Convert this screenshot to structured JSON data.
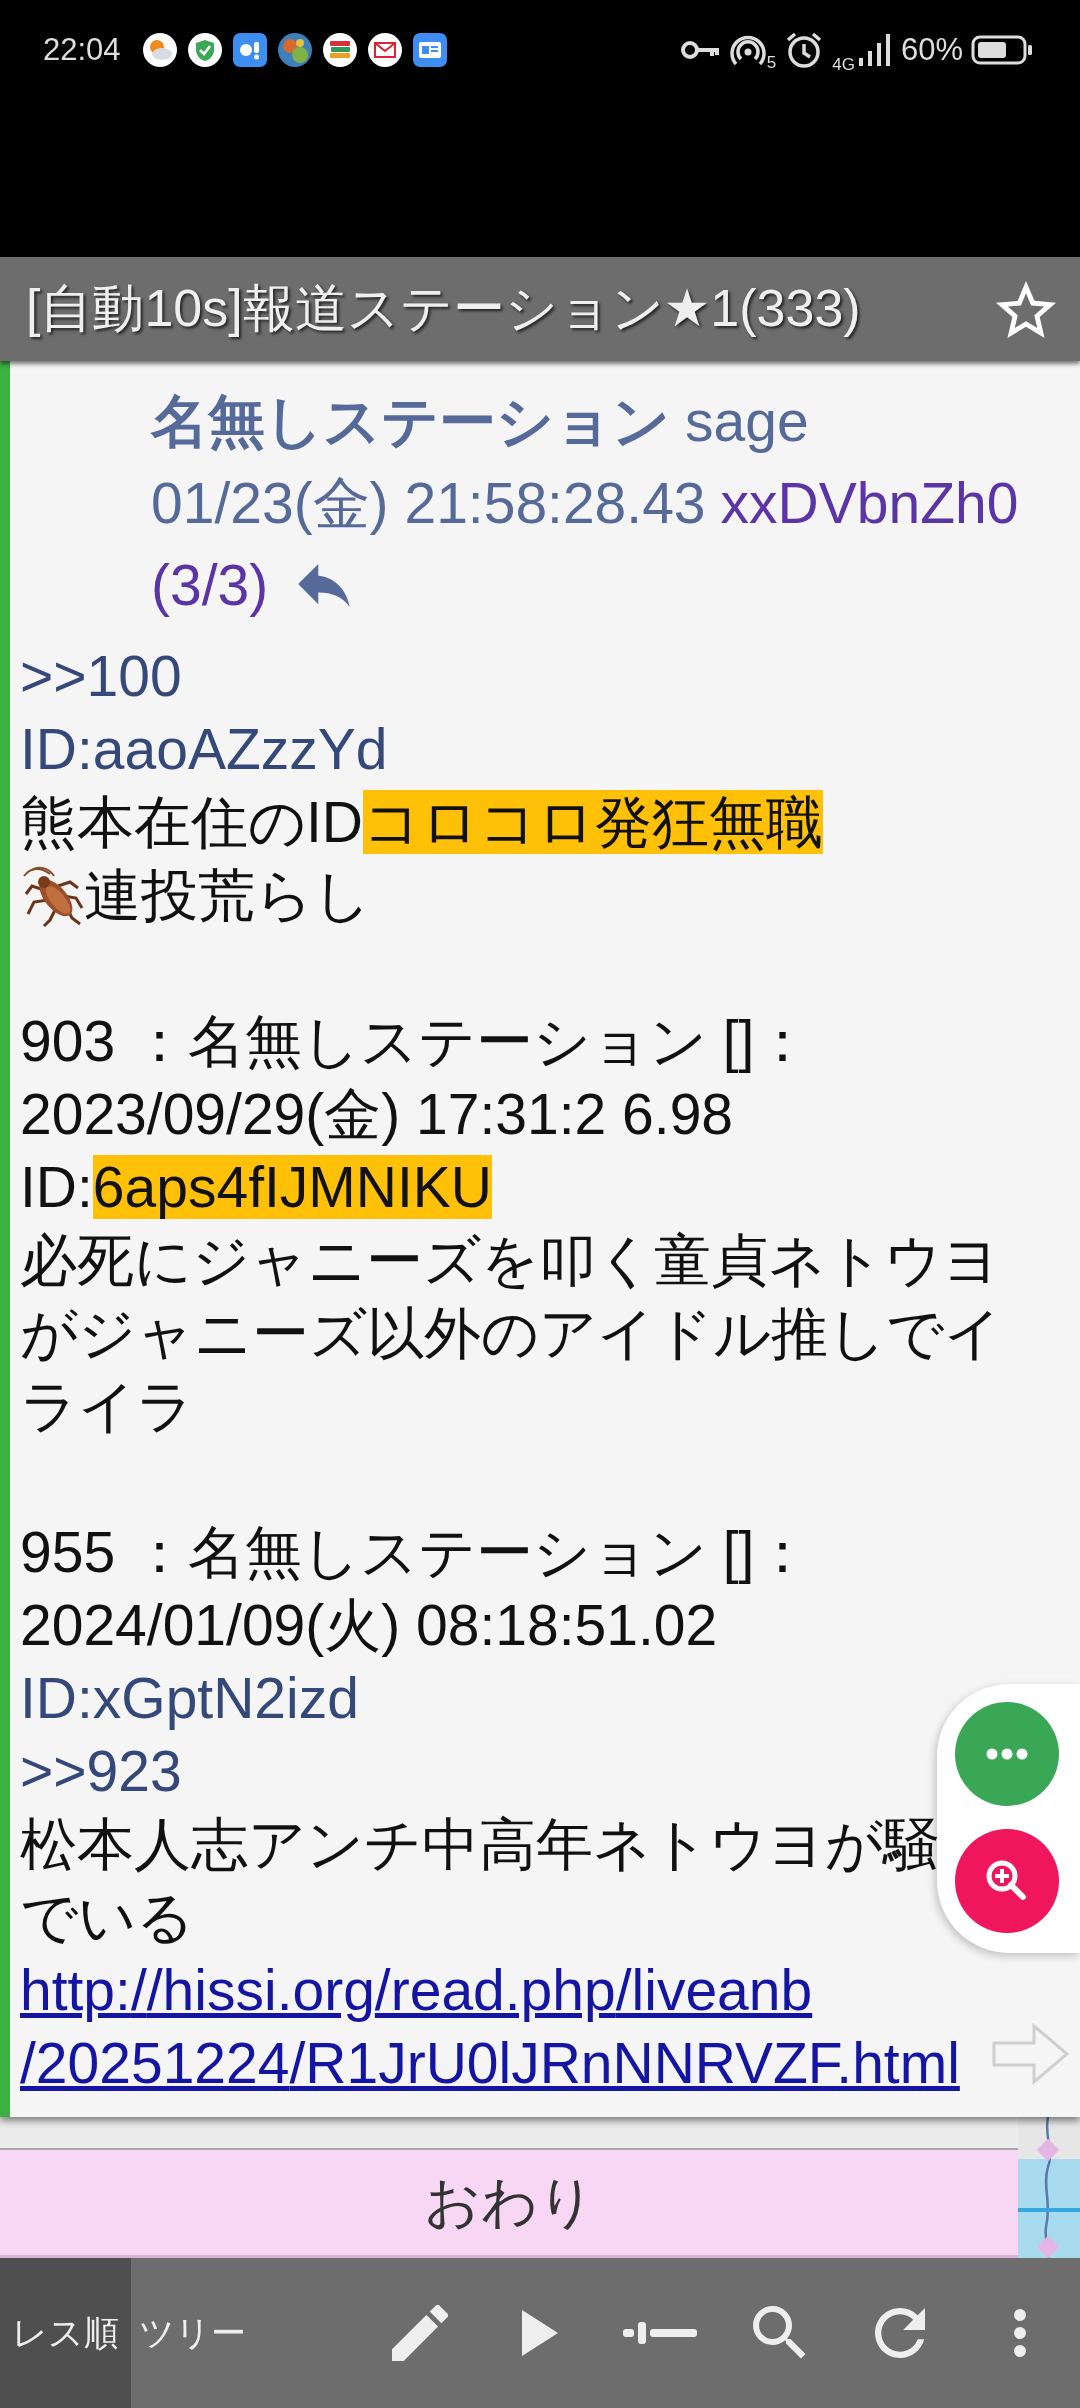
{
  "status_bar": {
    "time": "22:04",
    "hotspot_count": "5",
    "network": "4G",
    "battery": "60%"
  },
  "title_bar": {
    "title": "[自動10s]報道ステーション★1(333)",
    "favorite": false
  },
  "popup": {
    "name": "名無しステーション",
    "mail": "sage",
    "date": "01/23(金) 21:58:28.43",
    "id": "xxDVbnZh0",
    "count": "(3/3)",
    "body": [
      {
        "lines": [
          {
            "kind": "anchor",
            "text": ">>100"
          },
          {
            "kind": "id",
            "text": "ID:aaoAZzzYd"
          },
          {
            "kind": "marked",
            "segments": [
              {
                "text": "熊本在住のID",
                "highlighted": false
              },
              {
                "text": "コロコロ発狂無職",
                "highlighted": true
              }
            ]
          },
          {
            "kind": "emoji",
            "text": "連投荒らし"
          }
        ]
      },
      {
        "lines": [
          {
            "kind": "text",
            "text": "903 ：名無しステーション []："
          },
          {
            "kind": "text",
            "text": "2023/09/29(金) 17:31:2 6.98"
          },
          {
            "kind": "marked",
            "segments": [
              {
                "text": "ID:",
                "highlighted": false
              },
              {
                "text": "6aps4fIJMNIKU",
                "highlighted": true
              }
            ]
          },
          {
            "kind": "text",
            "text": "必死にジャニーズを叩く童貞ネトウヨがジャニーズ以外のアイドル推しでイライラ"
          }
        ]
      },
      {
        "lines": [
          {
            "kind": "text",
            "text": "955 ：名無しステーション []："
          },
          {
            "kind": "text",
            "text": "2024/01/09(火) 08:18:51.02"
          },
          {
            "kind": "id",
            "text": "ID:xGptN2izd"
          },
          {
            "kind": "anchor",
            "text": ">>923"
          },
          {
            "kind": "text",
            "text": "松本人志アンチ中高年ネトウヨが騒"
          },
          {
            "kind": "text",
            "text": "でいる"
          },
          {
            "kind": "link",
            "text": "http://hissi.org/read.php/liveanb/20251224/R1JrU0lJRnNNRVZF.html"
          }
        ]
      }
    ]
  },
  "list_end": {
    "label": "おわり"
  },
  "toolbar": {
    "tabs": [
      {
        "label": "レス順",
        "selected": true
      },
      {
        "label": "ツリー",
        "selected": false
      }
    ]
  }
}
